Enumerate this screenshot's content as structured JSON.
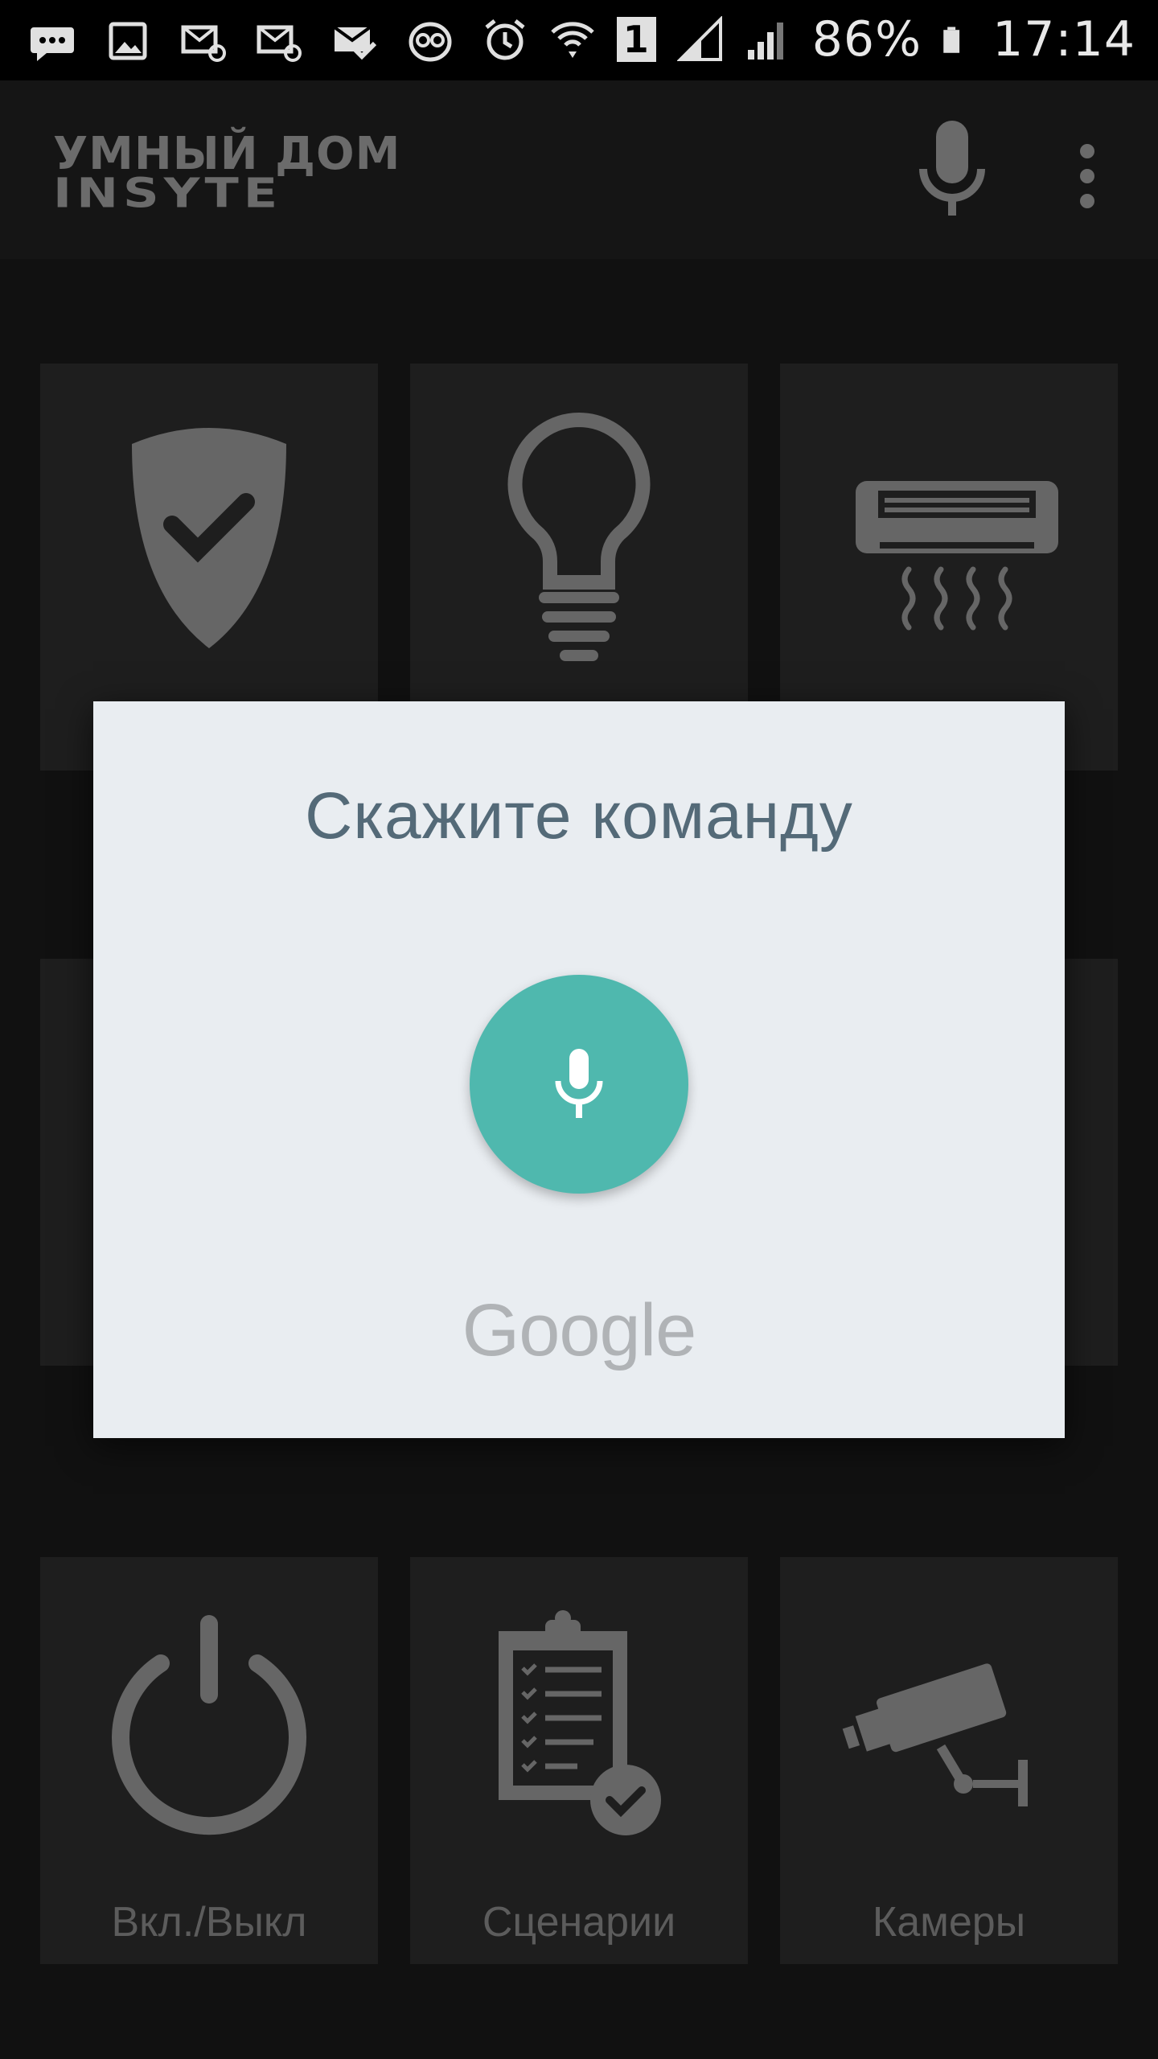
{
  "status_bar": {
    "battery": "86%",
    "time": "17:14",
    "sim_slot": "1",
    "left_icons": [
      "chat-icon",
      "image-icon",
      "mail-at-icon",
      "mail-at-icon",
      "mail-check-icon",
      "owl-icon"
    ],
    "right_icons": [
      "alarm-icon",
      "wifi-icon",
      "sim-icon",
      "signal-icon",
      "signal-icon",
      "battery-icon"
    ]
  },
  "app_bar": {
    "logo_line1": "УМНЫЙ ДОМ",
    "logo_line2": "INSYTE",
    "actions": [
      "microphone-icon",
      "more-vert-icon"
    ]
  },
  "tiles": [
    {
      "icon": "shield-check-icon",
      "label": ""
    },
    {
      "icon": "lightbulb-icon",
      "label": ""
    },
    {
      "icon": "air-conditioner-icon",
      "label": ""
    },
    {
      "icon": "power-icon",
      "label": "Вкл./Выкл"
    },
    {
      "icon": "clipboard-check-icon",
      "label": "Сценарии"
    },
    {
      "icon": "security-camera-icon",
      "label": "Камеры"
    }
  ],
  "voice_dialog": {
    "prompt": "Скажите команду",
    "brand": "Google",
    "mic_color": "#4fb8ae",
    "background": "#e9edf1",
    "prompt_color": "#546a78"
  },
  "colors": {
    "background": "#111111",
    "tile": "#1e1e1e",
    "tile_icon": "#666666",
    "status_bar": "#000000"
  }
}
